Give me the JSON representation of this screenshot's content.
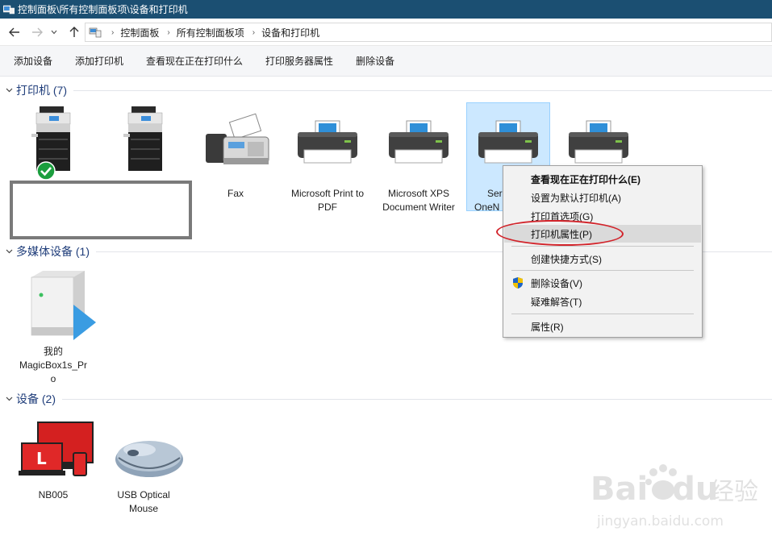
{
  "window": {
    "title": "控制面板\\所有控制面板项\\设备和打印机"
  },
  "breadcrumb": [
    "控制面板",
    "所有控制面板项",
    "设备和打印机"
  ],
  "toolbar": {
    "add_device": "添加设备",
    "add_printer": "添加打印机",
    "see_printing": "查看现在正在打印什么",
    "print_server_props": "打印服务器属性",
    "remove_device": "删除设备"
  },
  "groups": {
    "printers": {
      "title": "打印机 (7)"
    },
    "multimedia": {
      "title": "多媒体设备 (1)"
    },
    "devices": {
      "title": "设备 (2)"
    }
  },
  "printers": [
    {
      "label": ""
    },
    {
      "label": ""
    },
    {
      "label": "Fax"
    },
    {
      "label": "Microsoft Print to PDF"
    },
    {
      "label": "Microsoft XPS Document Writer"
    },
    {
      "label": "Send To OneNote 2016"
    },
    {
      "label": ""
    }
  ],
  "printer5_visible": [
    "Ser",
    "OneN"
  ],
  "multimedia": [
    {
      "label": "我的 MagicBox1s_Pro"
    }
  ],
  "multimedia_lines": [
    "我的",
    "MagicBox1s_Pr",
    "o"
  ],
  "devices": [
    {
      "label": "NB005"
    },
    {
      "label": "USB Optical Mouse"
    }
  ],
  "context_menu": {
    "see_printing": "查看现在正在打印什么(E)",
    "set_default": "设置为默认打印机(A)",
    "preferences": "打印首选项(G)",
    "printer_props": "打印机属性(P)",
    "create_shortcut": "创建快捷方式(S)",
    "remove_device": "删除设备(V)",
    "troubleshoot": "疑难解答(T)",
    "properties": "属性(R)"
  },
  "watermark": {
    "brand": "Bai",
    "brand2": "du",
    "cn": "经验",
    "url": "jingyan.baidu.com"
  },
  "colors": {
    "titlebar": "#1b4f72",
    "selected": "#cce8ff",
    "annotation": "#d2232a",
    "group_title": "#1f3d7a"
  }
}
